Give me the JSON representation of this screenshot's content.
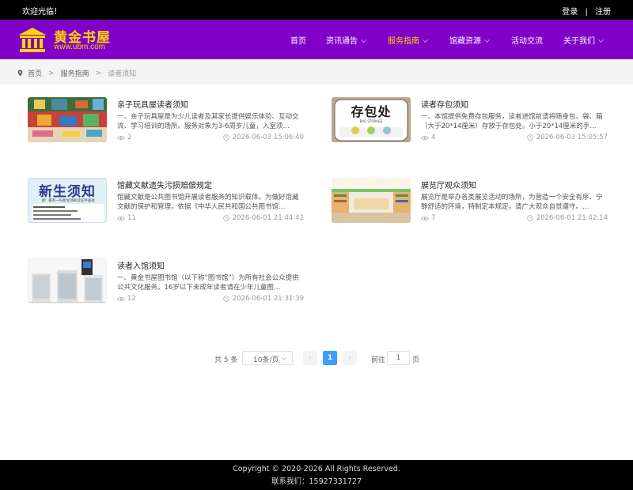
{
  "topbar": {
    "welcome": "欢迎光临！",
    "login": "登录",
    "separator": "|",
    "register": "注册"
  },
  "brand": {
    "name": "黄金书屋",
    "url": "www.ubm.com",
    "icon": "library-building-icon",
    "accent_color": "#ffd400",
    "header_color": "#8000c8"
  },
  "nav": {
    "items": [
      {
        "label": "首页",
        "has_dropdown": false,
        "active": false
      },
      {
        "label": "资讯通告",
        "has_dropdown": true,
        "active": false
      },
      {
        "label": "服务指南",
        "has_dropdown": true,
        "active": true
      },
      {
        "label": "馆藏资源",
        "has_dropdown": true,
        "active": false
      },
      {
        "label": "活动交流",
        "has_dropdown": false,
        "active": false
      },
      {
        "label": "关于我们",
        "has_dropdown": true,
        "active": false
      }
    ]
  },
  "breadcrumb": {
    "home": "首页",
    "level1": "服务指南",
    "current": "读者须知",
    "arrow": ">"
  },
  "articles": [
    {
      "title": "亲子玩具屋读者须知",
      "desc": "一、亲子玩具屋是为少儿读者及其家长提供娱乐体验、互动交流、学习培训的场所。服务对象为3-6周岁儿童，入室须…",
      "views": "2",
      "date": "2026-06-03 15:06:40",
      "thumb": "playroom-photo"
    },
    {
      "title": "读者存包须知",
      "desc": "一、本馆提供免费存包服务，读者进馆前请将随身包、袋、箱（大于20*14厘米）存放于存包处。小于20*14厘米的手…",
      "views": "4",
      "date": "2026-06-03 15:05:57",
      "thumb": "bag-storage-sign",
      "thumb_text": "存包处",
      "thumb_subtext": "BAG STORAGE"
    },
    {
      "title": "馆藏文献遗失污损赔偿规定",
      "desc": "馆藏文献是公共图书馆开展读者服务的知识载体。为做好馆藏文献的保护和管理，依据《中华人民共和国公共图书馆…",
      "views": "11",
      "date": "2026-06-01 21:44:42",
      "thumb": "new-student-notice",
      "thumb_text": "新生须知",
      "thumb_subtext": "请！看有一份新生须知读证件查收"
    },
    {
      "title": "展览厅观众须知",
      "desc": "展览厅是举办各类展览活动的场所，为营造一个安全有序、宁静舒适的环境，特制定本规定，请广大观众自觉遵守。…",
      "views": "7",
      "date": "2026-06-01 21:42:14",
      "thumb": "exhibition-hall-photo"
    },
    {
      "title": "读者入馆须知",
      "desc": "一、黄金书屋图书馆（以下称“图书馆”）为所有社会公众提供公共文化服务。16岁以下未成年读者请在少年儿童图…",
      "views": "12",
      "date": "2026-06-01 21:31:39",
      "thumb": "entrance-gates-photo"
    }
  ],
  "pagination": {
    "total": "共 5 条",
    "page_size": "10条/页",
    "prev": "‹",
    "current_page": "1",
    "next": "›",
    "goto_label": "前往",
    "goto_value": "1",
    "goto_unit": "页",
    "active_color": "#409eff"
  },
  "footer": {
    "copyright": "Copyright © 2020-2026 All Rights Reserved.",
    "contact": "联系我们：15927331727"
  }
}
